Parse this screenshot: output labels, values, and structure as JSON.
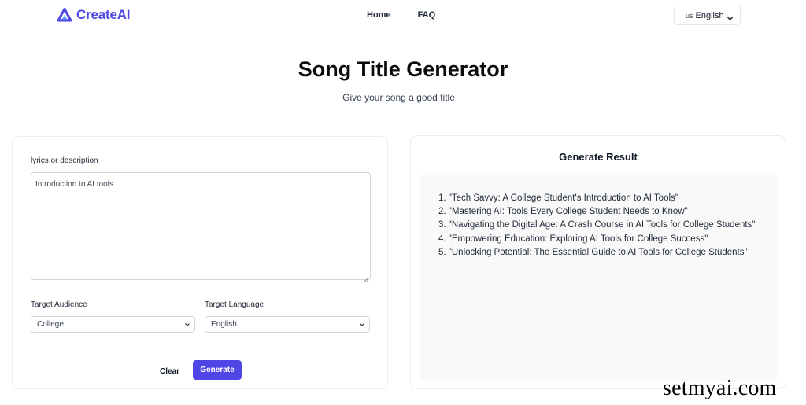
{
  "header": {
    "brand": "CreateAI",
    "brand_color": "#4f46e5",
    "nav": [
      {
        "label": "Home"
      },
      {
        "label": "FAQ"
      }
    ],
    "language": {
      "flag": "us",
      "label": "English"
    }
  },
  "hero": {
    "title": "Song Title Generator",
    "subtitle": "Give your song a good title"
  },
  "form": {
    "lyrics_label": "lyrics or description",
    "lyrics_value": "Introduction to AI tools",
    "audience_label": "Target Audience",
    "audience_value": "College",
    "language_label": "Target Language",
    "language_value": "English",
    "clear_label": "Clear",
    "generate_label": "Generate",
    "accent_color": "#4f46e5"
  },
  "result": {
    "title": "Generate Result",
    "items": [
      "1. \"Tech Savvy: A College Student's Introduction to AI Tools\"",
      "2. \"Mastering AI: Tools Every College Student Needs to Know\"",
      "3. \"Navigating the Digital Age: A Crash Course in AI Tools for College Students\"",
      "4. \"Empowering Education: Exploring AI Tools for College Success\"",
      "5. \"Unlocking Potential: The Essential Guide to AI Tools for College Students\""
    ]
  },
  "watermark": "setmyai.com"
}
